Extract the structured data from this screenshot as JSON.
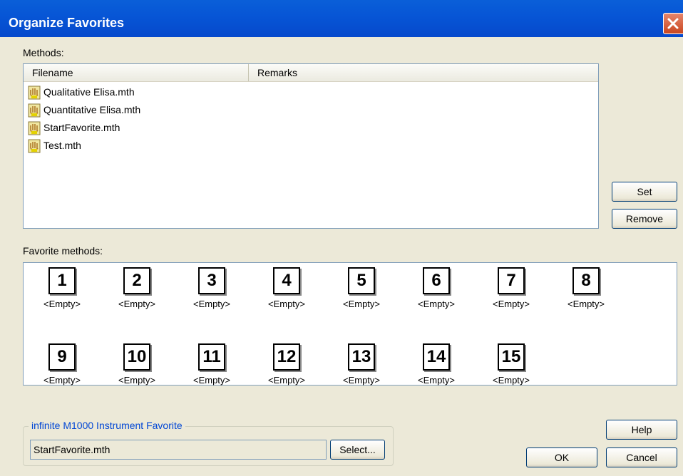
{
  "window": {
    "title": "Organize Favorites"
  },
  "methods": {
    "label": "Methods:",
    "columns": [
      "Filename",
      "Remarks"
    ],
    "files": [
      {
        "name": "Qualitative Elisa.mth",
        "icon": "method-file-icon"
      },
      {
        "name": "Quantitative Elisa.mth",
        "icon": "method-file-icon"
      },
      {
        "name": "StartFavorite.mth",
        "icon": "method-file-icon"
      },
      {
        "name": "Test.mth",
        "icon": "method-file-icon"
      }
    ]
  },
  "buttons": {
    "set": "Set",
    "remove": "Remove",
    "help": "Help",
    "ok": "OK",
    "cancel": "Cancel",
    "select": "Select..."
  },
  "favorites": {
    "label": "Favorite methods:",
    "slots": [
      {
        "number": "1",
        "value": "<Empty>"
      },
      {
        "number": "2",
        "value": "<Empty>"
      },
      {
        "number": "3",
        "value": "<Empty>"
      },
      {
        "number": "4",
        "value": "<Empty>"
      },
      {
        "number": "5",
        "value": "<Empty>"
      },
      {
        "number": "6",
        "value": "<Empty>"
      },
      {
        "number": "7",
        "value": "<Empty>"
      },
      {
        "number": "8",
        "value": "<Empty>"
      },
      {
        "number": "9",
        "value": "<Empty>"
      },
      {
        "number": "10",
        "value": "<Empty>"
      },
      {
        "number": "11",
        "value": "<Empty>"
      },
      {
        "number": "12",
        "value": "<Empty>"
      },
      {
        "number": "13",
        "value": "<Empty>"
      },
      {
        "number": "14",
        "value": "<Empty>"
      },
      {
        "number": "15",
        "value": "<Empty>"
      }
    ]
  },
  "instrument": {
    "group_title": "infinite M1000 Instrument Favorite",
    "value": "StartFavorite.mth"
  },
  "colors": {
    "titlebar": "#0756d6",
    "dialog_bg": "#ece9d8",
    "group_title": "#0046d5",
    "close_button": "#c9461f"
  }
}
